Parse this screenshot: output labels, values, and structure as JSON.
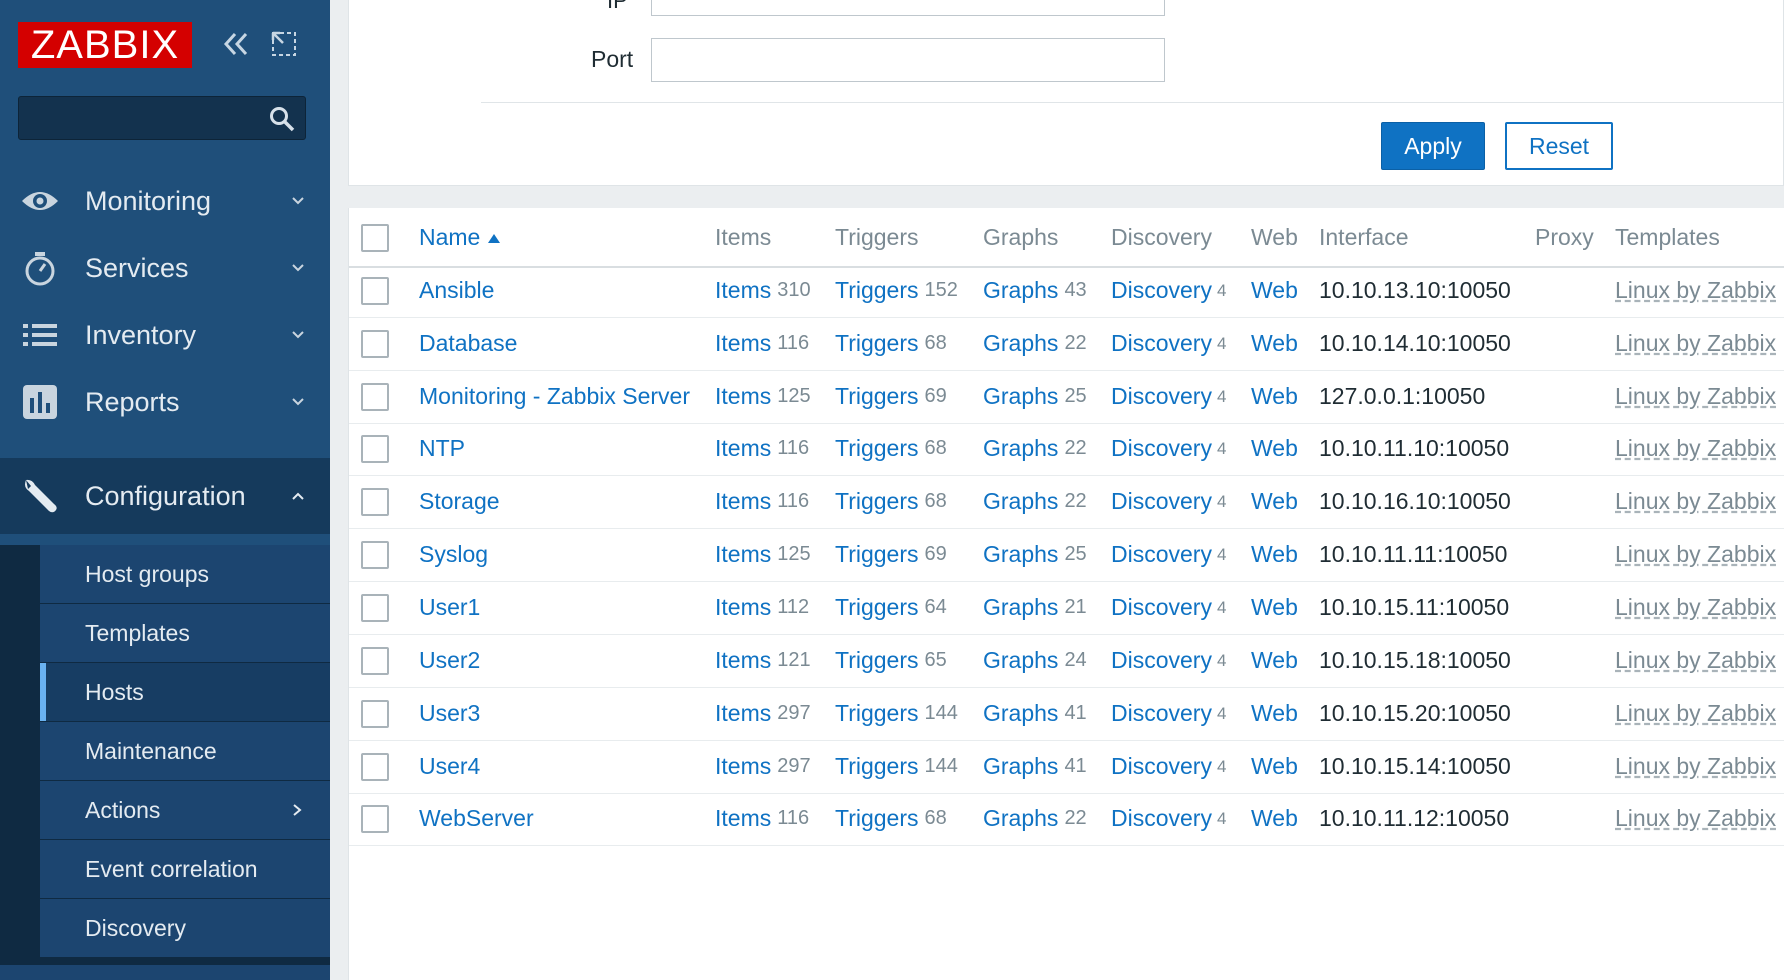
{
  "sidebar": {
    "logo": "ZABBIX",
    "search": {
      "value": "",
      "placeholder": ""
    },
    "menu": [
      {
        "label": "Monitoring",
        "icon": "eye-icon"
      },
      {
        "label": "Services",
        "icon": "stopwatch-icon"
      },
      {
        "label": "Inventory",
        "icon": "list-icon"
      },
      {
        "label": "Reports",
        "icon": "bar-chart-icon"
      },
      {
        "label": "Configuration",
        "icon": "wrench-icon",
        "expanded": true
      }
    ],
    "submenu": [
      {
        "label": "Host groups"
      },
      {
        "label": "Templates"
      },
      {
        "label": "Hosts",
        "selected": true
      },
      {
        "label": "Maintenance"
      },
      {
        "label": "Actions",
        "has_children": true
      },
      {
        "label": "Event correlation"
      },
      {
        "label": "Discovery"
      }
    ]
  },
  "filter": {
    "ip_label": "IP",
    "port_label": "Port",
    "port_value": "",
    "apply_label": "Apply",
    "reset_label": "Reset"
  },
  "table": {
    "headers": {
      "name": "Name",
      "items": "Items",
      "triggers": "Triggers",
      "graphs": "Graphs",
      "discovery": "Discovery",
      "web": "Web",
      "interface": "Interface",
      "proxy": "Proxy",
      "templates": "Templates"
    },
    "link_labels": {
      "items": "Items",
      "triggers": "Triggers",
      "graphs": "Graphs",
      "discovery": "Discovery",
      "web": "Web"
    },
    "rows": [
      {
        "name": "Ansible",
        "items": "310",
        "triggers": "152",
        "graphs": "43",
        "discovery": "4",
        "interface": "10.10.13.10:10050",
        "template": "Linux by Zabbix"
      },
      {
        "name": "Database",
        "items": "116",
        "triggers": "68",
        "graphs": "22",
        "discovery": "4",
        "interface": "10.10.14.10:10050",
        "template": "Linux by Zabbix"
      },
      {
        "name": "Monitoring - Zabbix Server",
        "items": "125",
        "triggers": "69",
        "graphs": "25",
        "discovery": "4",
        "interface": "127.0.0.1:10050",
        "template": "Linux by Zabbix"
      },
      {
        "name": "NTP",
        "items": "116",
        "triggers": "68",
        "graphs": "22",
        "discovery": "4",
        "interface": "10.10.11.10:10050",
        "template": "Linux by Zabbix"
      },
      {
        "name": "Storage",
        "items": "116",
        "triggers": "68",
        "graphs": "22",
        "discovery": "4",
        "interface": "10.10.16.10:10050",
        "template": "Linux by Zabbix"
      },
      {
        "name": "Syslog",
        "items": "125",
        "triggers": "69",
        "graphs": "25",
        "discovery": "4",
        "interface": "10.10.11.11:10050",
        "template": "Linux by Zabbix"
      },
      {
        "name": "User1",
        "items": "112",
        "triggers": "64",
        "graphs": "21",
        "discovery": "4",
        "interface": "10.10.15.11:10050",
        "template": "Linux by Zabbix"
      },
      {
        "name": "User2",
        "items": "121",
        "triggers": "65",
        "graphs": "24",
        "discovery": "4",
        "interface": "10.10.15.18:10050",
        "template": "Linux by Zabbix"
      },
      {
        "name": "User3",
        "items": "297",
        "triggers": "144",
        "graphs": "41",
        "discovery": "4",
        "interface": "10.10.15.20:10050",
        "template": "Linux by Zabbix"
      },
      {
        "name": "User4",
        "items": "297",
        "triggers": "144",
        "graphs": "41",
        "discovery": "4",
        "interface": "10.10.15.14:10050",
        "template": "Linux by Zabbix"
      },
      {
        "name": "WebServer",
        "items": "116",
        "triggers": "68",
        "graphs": "22",
        "discovery": "4",
        "interface": "10.10.11.12:10050",
        "template": "Linux by Zabbix"
      }
    ]
  },
  "colors": {
    "sidebar": "#1f4f7a",
    "link": "#0f72c3",
    "logo": "#d40000"
  }
}
